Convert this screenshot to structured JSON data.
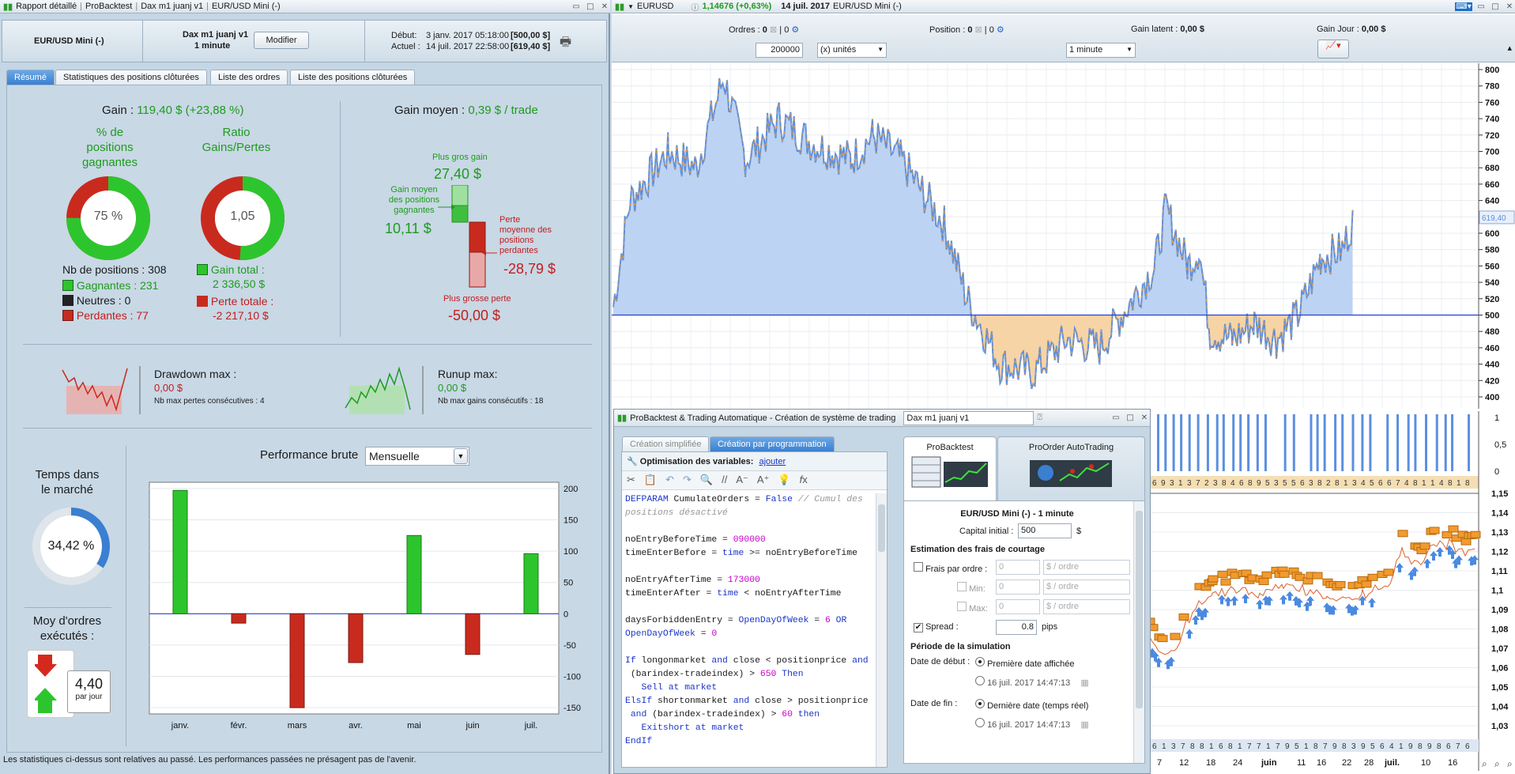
{
  "left_window": {
    "title_items": [
      "Rapport détaillé",
      "ProBacktest",
      "Dax m1 juanj v1",
      "EUR/USD Mini (-)"
    ],
    "instrument": "EUR/USD Mini (-)",
    "system_name": "Dax m1 juanj v1",
    "timeframe": "1 minute",
    "modify_label": "Modifier",
    "start_label": "Début:",
    "start_date": "3 janv. 2017 05:18:00",
    "start_value": "[500,00 $]",
    "end_label": "Actuel :",
    "end_date": "14 juil. 2017 22:58:00",
    "end_value": "[619,40 $]",
    "tabs": [
      "Résumé",
      "Statistiques des positions clôturées",
      "Liste des ordres",
      "Liste des positions clôturées"
    ],
    "gain_label": "Gain :",
    "gain_value": "119,40 $ (+23,88 %)",
    "pct_winning_label": "% de\npositions\ngagnantes",
    "pct_winning_value": "75 %",
    "ratio_label": "Ratio\nGains/Pertes",
    "ratio_value": "1,05",
    "nb_positions": "Nb de positions : 308",
    "winners": "Gagnantes : 231",
    "neutral": "Neutres : 0",
    "losers": "Perdantes : 77",
    "gain_total_label": "Gain total :",
    "gain_total_value": "2 336,50 $",
    "loss_total_label": "Perte totale :",
    "loss_total_value": "-2 217,10 $",
    "avg_gain_label": "Gain moyen :",
    "avg_gain_value": "0,39 $ / trade",
    "biggest_gain_label": "Plus gros gain",
    "biggest_gain_value": "27,40 $",
    "avg_win_label": "Gain moyen\ndes positions\ngagnantes",
    "avg_win_value": "10,11 $",
    "avg_loss_label": "Perte\nmoyenne des\npositions\nperdantes",
    "avg_loss_value": "-28,79 $",
    "biggest_loss_label": "Plus grosse perte",
    "biggest_loss_value": "-50,00 $",
    "drawdown_label": "Drawdown max :",
    "drawdown_value": "0,00 $",
    "drawdown_sub": "Nb max pertes consécutives : 4",
    "runup_label": "Runup max:",
    "runup_value": "0,00 $",
    "runup_sub": "Nb max gains consécutifs : 18",
    "time_market_label": "Temps dans\nle marché",
    "time_market_value": "34,42 %",
    "time_market_fraction": 0.3442,
    "avg_orders_label": "Moy d'ordres\nexécutés :",
    "avg_orders_value": "4,40",
    "avg_orders_unit": "par jour",
    "perf_label": "Performance brute",
    "perf_select": "Mensuelle",
    "footer": "Les statistiques ci-dessus sont relatives au passé. Les performances passées ne présagent pas de l'avenir.",
    "win_fraction": 0.75,
    "ratio_fraction": 0.51
  },
  "chart_data": {
    "type": "bar",
    "title": "Performance brute",
    "categories": [
      "janv.",
      "févr.",
      "mars",
      "avr.",
      "mai",
      "juin",
      "juil."
    ],
    "values": [
      197,
      -15,
      -150,
      -78,
      125,
      -65,
      96
    ],
    "ylim": [
      -160,
      210
    ],
    "yticks": [
      200,
      150,
      100,
      50,
      0,
      -50,
      -100,
      -150
    ],
    "colors": {
      "positive": "#2dc52d",
      "negative": "#c92a1e"
    }
  },
  "right_window": {
    "symbol": "EURUSD",
    "price": "1,14676 (+0,63%)",
    "date": "14 juil. 2017",
    "instrument": "EUR/USD Mini (-)",
    "orders_label": "Ordres :",
    "orders_value": "0",
    "orders_count": "0",
    "position_label": "Position :",
    "position_value": "0",
    "position_count": "0",
    "unrealized_label": "Gain latent :",
    "unrealized_value": "0,00 $",
    "day_gain_label": "Gain Jour :",
    "day_gain_value": "0,00 $",
    "quantity": "200000",
    "unit_select": "(x) unités",
    "timeframe_select": "1 minute",
    "equity_axis": [
      "800",
      "780",
      "760",
      "740",
      "720",
      "700",
      "680",
      "660",
      "640",
      "620",
      "600",
      "580",
      "560",
      "540",
      "520",
      "500",
      "480",
      "460",
      "440",
      "420",
      "400"
    ],
    "equity_last": "619,40",
    "volume_axis": [
      "1",
      "0,5",
      "0"
    ],
    "price_axis": [
      "1,15",
      "1,14",
      "1,13",
      "1,12",
      "1,11",
      "1,1",
      "1,09",
      "1,08",
      "1,07",
      "1,06",
      "1,05",
      "1,04",
      "1,03"
    ],
    "date_axis": [
      "7",
      "12",
      "18",
      "24",
      "juin",
      "11",
      "16",
      "22",
      "28",
      "juil.",
      "10",
      "16"
    ]
  },
  "editor": {
    "title": "ProBacktest & Trading Automatique - Création de système de trading",
    "system_name": "Dax m1 juanj v1",
    "tabs": [
      "Création simplifiée",
      "Création par programmation"
    ],
    "optim_label": "Optimisation des variables:",
    "optim_link": "ajouter",
    "right_tabs": [
      "ProBacktest",
      "ProOrder AutoTrading"
    ],
    "instrument_line": "EUR/USD Mini (-) - 1 minute",
    "capital_label": "Capital initial :",
    "capital_value": "500",
    "capital_unit": "$",
    "fees_title": "Estimation des frais de courtage",
    "fee_order_label": "Frais par ordre :",
    "fee_min_label": "Min:",
    "fee_max_label": "Max:",
    "fee_placeholder": "0",
    "fee_unit": "$ / ordre",
    "spread_label": "Spread :",
    "spread_value": "0.8",
    "spread_unit": "pips",
    "period_title": "Période de la simulation",
    "start_label": "Date de début :",
    "start_opt1": "Première date affichée",
    "start_opt2": "16 juil. 2017 14:47:13",
    "end_label": "Date de fin :",
    "end_opt1": "Dernière date (temps réel)",
    "end_opt2": "16 juil. 2017 14:47:13"
  }
}
